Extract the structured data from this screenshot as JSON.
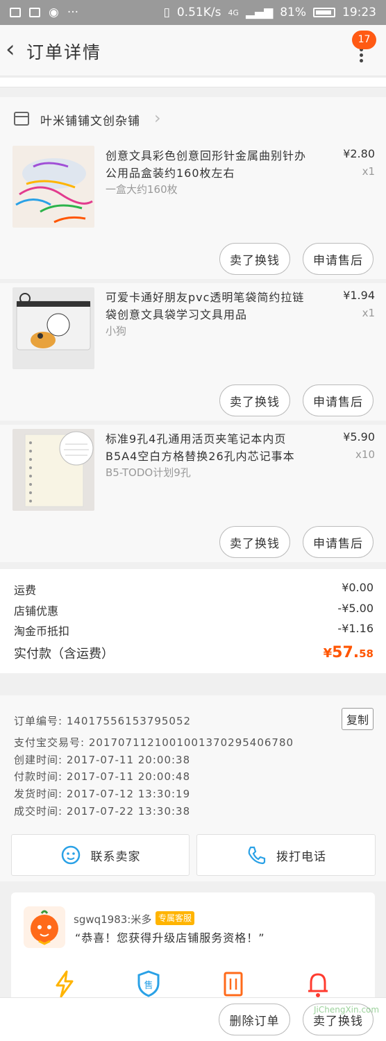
{
  "status_bar": {
    "speed": "0.51K/s",
    "network": "4G",
    "battery": "81%",
    "time": "19:23"
  },
  "header": {
    "title": "订单详情",
    "badge": "17"
  },
  "shop": {
    "name": "叶米铺铺文创杂铺"
  },
  "items": [
    {
      "title": "创意文具彩色创意回形针金属曲别针办公用品盒装约160枚左右",
      "sku": "一盒大约160枚",
      "price": "¥2.80",
      "qty": "x1",
      "btn_sell": "卖了换钱",
      "btn_after": "申请售后"
    },
    {
      "title": "可爱卡通好朋友pvc透明笔袋简约拉链袋创意文具袋学习文具用品",
      "sku": "小狗",
      "price": "¥1.94",
      "qty": "x1",
      "btn_sell": "卖了换钱",
      "btn_after": "申请售后"
    },
    {
      "title": "标准9孔4孔通用活页夹笔记本内页B5A4空白方格替换26孔内芯记事本",
      "sku": "B5-TODO计划9孔",
      "price": "¥5.90",
      "qty": "x10",
      "btn_sell": "卖了换钱",
      "btn_after": "申请售后"
    }
  ],
  "summary": {
    "shipping_label": "运费",
    "shipping_value": "¥0.00",
    "discount_label": "店铺优惠",
    "discount_value": "-¥5.00",
    "coin_label": "淘金币抵扣",
    "coin_value": "-¥1.16",
    "total_label": "实付款（含运费）",
    "total_symbol": "¥",
    "total_int": "57.",
    "total_dec": "58"
  },
  "order_info": {
    "order_no": "订单编号: 14017556153795052",
    "copy_label": "复制",
    "alipay_no": "支付宝交易号: 2017071121001001370295406780",
    "created": "创建时间: 2017-07-11 20:00:38",
    "paid": "付款时间: 2017-07-11 20:00:48",
    "shipped": "发货时间: 2017-07-12 13:30:19",
    "completed": "成交时间: 2017-07-22 13:30:38"
  },
  "contact": {
    "seller_label": "联系卖家",
    "phone_label": "拨打电话"
  },
  "service": {
    "name": "sgwq1983:米多",
    "tag": "专属客服",
    "message": "“恭喜！您获得升级店铺服务资格！”"
  },
  "bottom": {
    "delete_label": "删除订单",
    "sell_label": "卖了换钱"
  },
  "watermark": "JiChengXin.com",
  "colors": {
    "accent": "#ff5500",
    "badge": "#ff5a14",
    "blue": "#2aa1e6",
    "tag": "#ffb400"
  }
}
